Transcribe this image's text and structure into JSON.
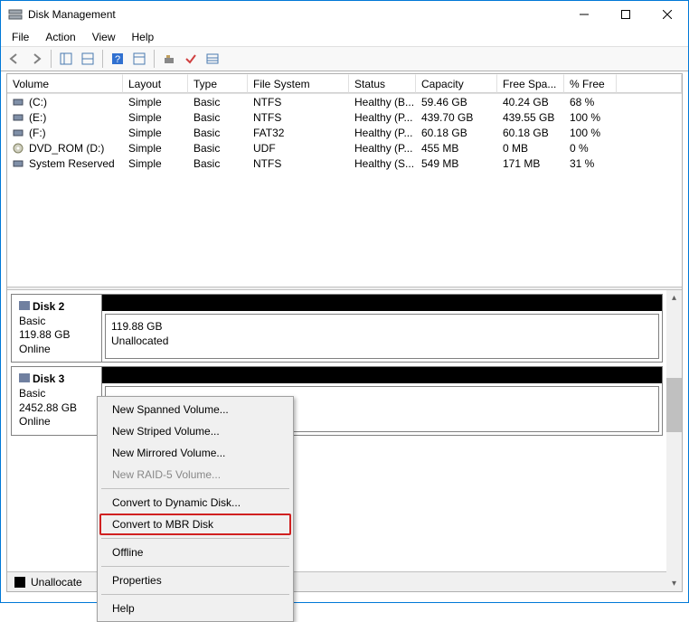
{
  "window": {
    "title": "Disk Management"
  },
  "menu": {
    "file": "File",
    "action": "Action",
    "view": "View",
    "help": "Help"
  },
  "columns": {
    "volume": "Volume",
    "layout": "Layout",
    "type": "Type",
    "fs": "File System",
    "status": "Status",
    "capacity": "Capacity",
    "free": "Free Spa...",
    "pfree": "% Free"
  },
  "volumes": [
    {
      "name": "(C:)",
      "layout": "Simple",
      "type": "Basic",
      "fs": "NTFS",
      "status": "Healthy (B...",
      "capacity": "59.46 GB",
      "free": "40.24 GB",
      "pfree": "68 %",
      "icon": "disk"
    },
    {
      "name": "(E:)",
      "layout": "Simple",
      "type": "Basic",
      "fs": "NTFS",
      "status": "Healthy (P...",
      "capacity": "439.70 GB",
      "free": "439.55 GB",
      "pfree": "100 %",
      "icon": "disk"
    },
    {
      "name": "(F:)",
      "layout": "Simple",
      "type": "Basic",
      "fs": "FAT32",
      "status": "Healthy (P...",
      "capacity": "60.18 GB",
      "free": "60.18 GB",
      "pfree": "100 %",
      "icon": "disk"
    },
    {
      "name": "DVD_ROM (D:)",
      "layout": "Simple",
      "type": "Basic",
      "fs": "UDF",
      "status": "Healthy (P...",
      "capacity": "455 MB",
      "free": "0 MB",
      "pfree": "0 %",
      "icon": "dvd"
    },
    {
      "name": "System Reserved",
      "layout": "Simple",
      "type": "Basic",
      "fs": "NTFS",
      "status": "Healthy (S...",
      "capacity": "549 MB",
      "free": "171 MB",
      "pfree": "31 %",
      "icon": "disk"
    }
  ],
  "disks": [
    {
      "label": "Disk 2",
      "type": "Basic",
      "size": "119.88 GB",
      "state": "Online",
      "vol_size": "119.88 GB",
      "vol_state": "Unallocated"
    },
    {
      "label": "Disk 3",
      "type": "Basic",
      "size": "2452.88 GB",
      "state": "Online",
      "vol_size": "",
      "vol_state": ""
    }
  ],
  "legend": {
    "unalloc": "Unallocate"
  },
  "context": {
    "spanned": "New Spanned Volume...",
    "striped": "New Striped Volume...",
    "mirrored": "New Mirrored Volume...",
    "raid5": "New RAID-5 Volume...",
    "dynamic": "Convert to Dynamic Disk...",
    "mbr": "Convert to MBR Disk",
    "offline": "Offline",
    "properties": "Properties",
    "help": "Help"
  }
}
